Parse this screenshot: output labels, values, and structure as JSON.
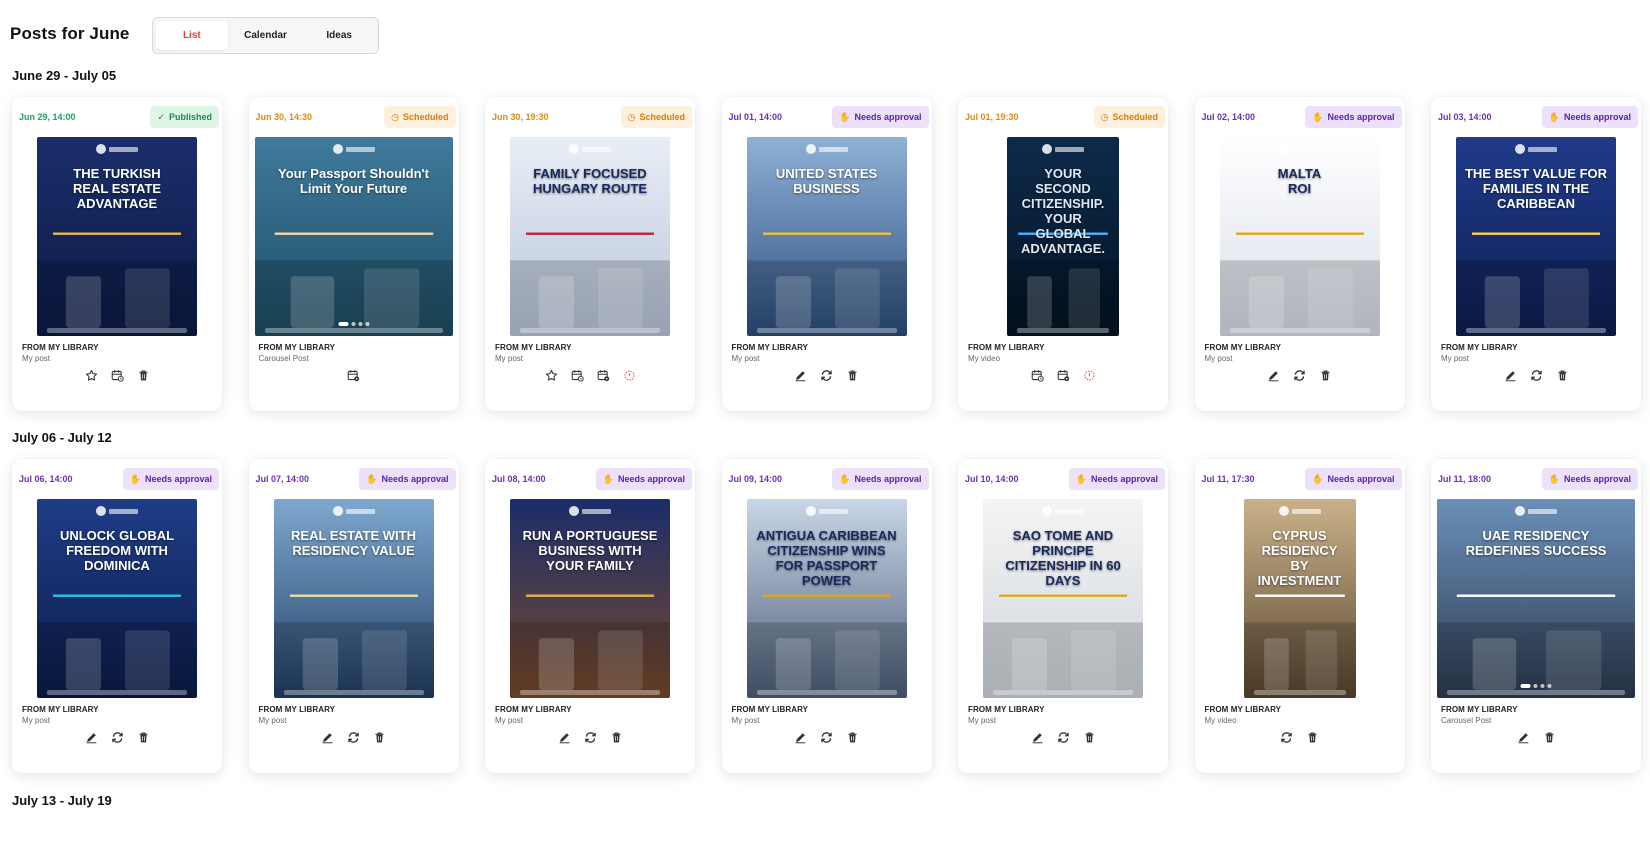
{
  "header": {
    "title": "Posts for June",
    "tabs": [
      {
        "label": "List",
        "active": true
      },
      {
        "label": "Calendar",
        "active": false
      },
      {
        "label": "Ideas",
        "active": false
      }
    ]
  },
  "colors": {
    "accent_red": "#e0452f",
    "published": "#1aa361",
    "scheduled": "#e08a12",
    "needs_approval": "#6b2fb5"
  },
  "weeks": [
    {
      "label": "June 29 - July 05",
      "posts": [
        {
          "date": "Jun 29, 14:00",
          "status": "Published",
          "status_icon": "check-icon",
          "source": "FROM MY LIBRARY",
          "kind": "My post",
          "headline": "THE TURKISH\nREAL ESTATE ADVANTAGE",
          "actions": [
            "star-icon",
            "reschedule-icon",
            "delete-icon"
          ]
        },
        {
          "date": "Jun 30, 14:30",
          "status": "Scheduled",
          "status_icon": "clock-icon",
          "source": "FROM MY LIBRARY",
          "kind": "Carousel Post",
          "headline": "Your Passport Shouldn't Limit Your Future",
          "actions": [
            "calendar-settings-icon"
          ]
        },
        {
          "date": "Jun 30, 19:30",
          "status": "Scheduled",
          "status_icon": "clock-icon",
          "source": "FROM MY LIBRARY",
          "kind": "My post",
          "headline": "FAMILY FOCUSED\nHUNGARY ROUTE",
          "actions": [
            "star-icon",
            "reschedule-icon",
            "calendar-settings-icon",
            "error-icon"
          ]
        },
        {
          "date": "Jul 01, 14:00",
          "status": "Needs approval",
          "status_icon": "hand-icon",
          "source": "FROM MY LIBRARY",
          "kind": "My post",
          "headline": "UNITED STATES BUSINESS",
          "actions": [
            "edit-icon",
            "refresh-icon",
            "delete-icon"
          ]
        },
        {
          "date": "Jul 01, 19:30",
          "status": "Scheduled",
          "status_icon": "clock-icon",
          "source": "FROM MY LIBRARY",
          "kind": "My video",
          "headline": "YOUR SECOND CITIZENSHIP. YOUR GLOBAL ADVANTAGE.",
          "actions": [
            "reschedule-icon",
            "calendar-settings-icon",
            "error-icon"
          ]
        },
        {
          "date": "Jul 02, 14:00",
          "status": "Needs approval",
          "status_icon": "hand-icon",
          "source": "FROM MY LIBRARY",
          "kind": "My post",
          "headline": "MALTA\nROI",
          "actions": [
            "edit-icon",
            "refresh-icon",
            "delete-icon"
          ]
        },
        {
          "date": "Jul 03, 14:00",
          "status": "Needs approval",
          "status_icon": "hand-icon",
          "source": "FROM MY LIBRARY",
          "kind": "My post",
          "headline": "THE BEST VALUE FOR FAMILIES IN THE CARIBBEAN",
          "actions": [
            "edit-icon",
            "refresh-icon",
            "delete-icon"
          ]
        }
      ]
    },
    {
      "label": "July 06 - July 12",
      "posts": [
        {
          "date": "Jul 06, 14:00",
          "status": "Needs approval",
          "status_icon": "hand-icon",
          "source": "FROM MY LIBRARY",
          "kind": "My post",
          "headline": "UNLOCK GLOBAL FREEDOM WITH\nDOMINICA",
          "actions": [
            "edit-icon",
            "refresh-icon",
            "delete-icon"
          ]
        },
        {
          "date": "Jul 07, 14:00",
          "status": "Needs approval",
          "status_icon": "hand-icon",
          "source": "FROM MY LIBRARY",
          "kind": "My post",
          "headline": "REAL ESTATE WITH RESIDENCY VALUE",
          "actions": [
            "edit-icon",
            "refresh-icon",
            "delete-icon"
          ]
        },
        {
          "date": "Jul 08, 14:00",
          "status": "Needs approval",
          "status_icon": "hand-icon",
          "source": "FROM MY LIBRARY",
          "kind": "My post",
          "headline": "RUN A PORTUGUESE BUSINESS WITH YOUR FAMILY",
          "actions": [
            "edit-icon",
            "refresh-icon",
            "delete-icon"
          ]
        },
        {
          "date": "Jul 09, 14:00",
          "status": "Needs approval",
          "status_icon": "hand-icon",
          "source": "FROM MY LIBRARY",
          "kind": "My post",
          "headline": "ANTIGUA CARIBBEAN CITIZENSHIP WINS FOR PASSPORT POWER",
          "actions": [
            "edit-icon",
            "refresh-icon",
            "delete-icon"
          ]
        },
        {
          "date": "Jul 10, 14:00",
          "status": "Needs approval",
          "status_icon": "hand-icon",
          "source": "FROM MY LIBRARY",
          "kind": "My post",
          "headline": "SAO TOME AND PRINCIPE CITIZENSHIP IN 60 DAYS",
          "actions": [
            "edit-icon",
            "refresh-icon",
            "delete-icon"
          ]
        },
        {
          "date": "Jul 11, 17:30",
          "status": "Needs approval",
          "status_icon": "hand-icon",
          "source": "FROM MY LIBRARY",
          "kind": "My video",
          "headline": "CYPRUS RESIDENCY BY INVESTMENT",
          "actions": [
            "refresh-icon",
            "delete-icon"
          ]
        },
        {
          "date": "Jul 11, 18:00",
          "status": "Needs approval",
          "status_icon": "hand-icon",
          "source": "FROM MY LIBRARY",
          "kind": "Carousel Post",
          "headline": "UAE RESIDENCY\nREDEFINES SUCCESS",
          "actions": [
            "edit-icon",
            "delete-icon"
          ]
        }
      ]
    },
    {
      "label": "July 13 - July 19",
      "posts": []
    }
  ]
}
